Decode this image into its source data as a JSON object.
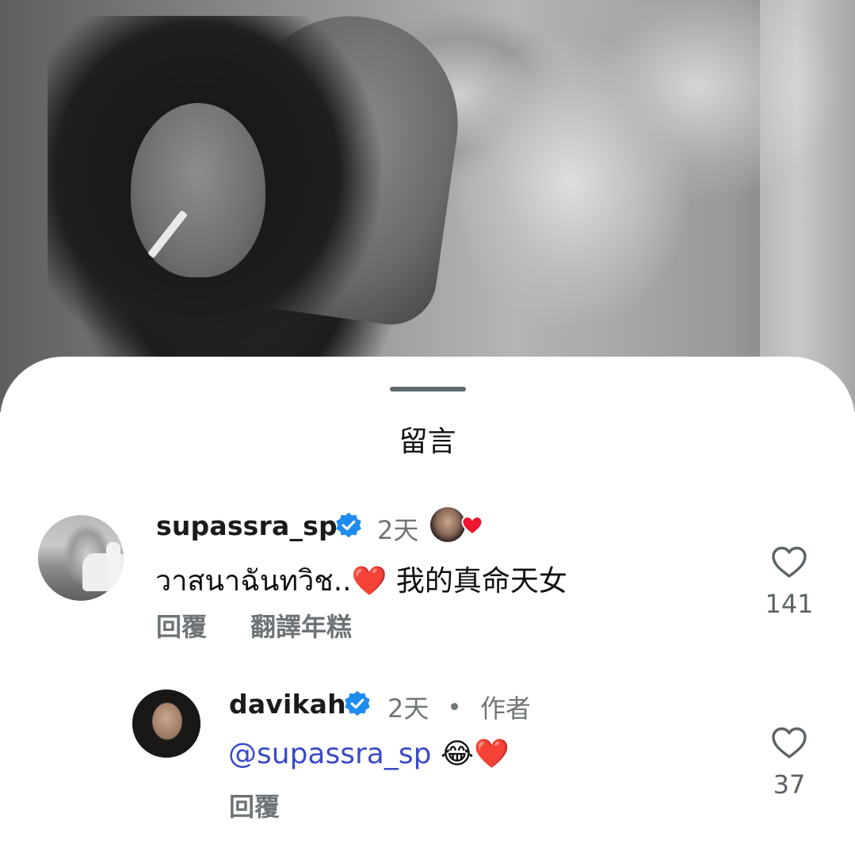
{
  "sheet": {
    "title": "留言"
  },
  "comments": [
    {
      "username": "supassra_sp",
      "verified": true,
      "time": "2天",
      "creator_liked": true,
      "text": "วาสนาฉันทวิช..",
      "text_emoji": "❤️",
      "text_suffix": "我的真命天女",
      "actions": [
        "回覆",
        "翻譯年糕"
      ],
      "like_count": "141",
      "avatar_icon": "avatar"
    },
    {
      "username": "davikah",
      "verified": true,
      "time": "2天",
      "badge": "作者",
      "mention": "@supassra_sp",
      "text_emoji": "😂❤️",
      "actions": [
        "回覆"
      ],
      "like_count": "37",
      "avatar_icon": "avatar"
    }
  ],
  "colors": {
    "verified_blue": "#1d8cf0",
    "mention_blue": "#3b4bc4",
    "heart_red": "#e0182d",
    "muted_text": "#707578"
  },
  "icons": [
    "verified-badge-icon",
    "heart-outline-icon",
    "red-heart-icon",
    "threads-at-icon"
  ]
}
